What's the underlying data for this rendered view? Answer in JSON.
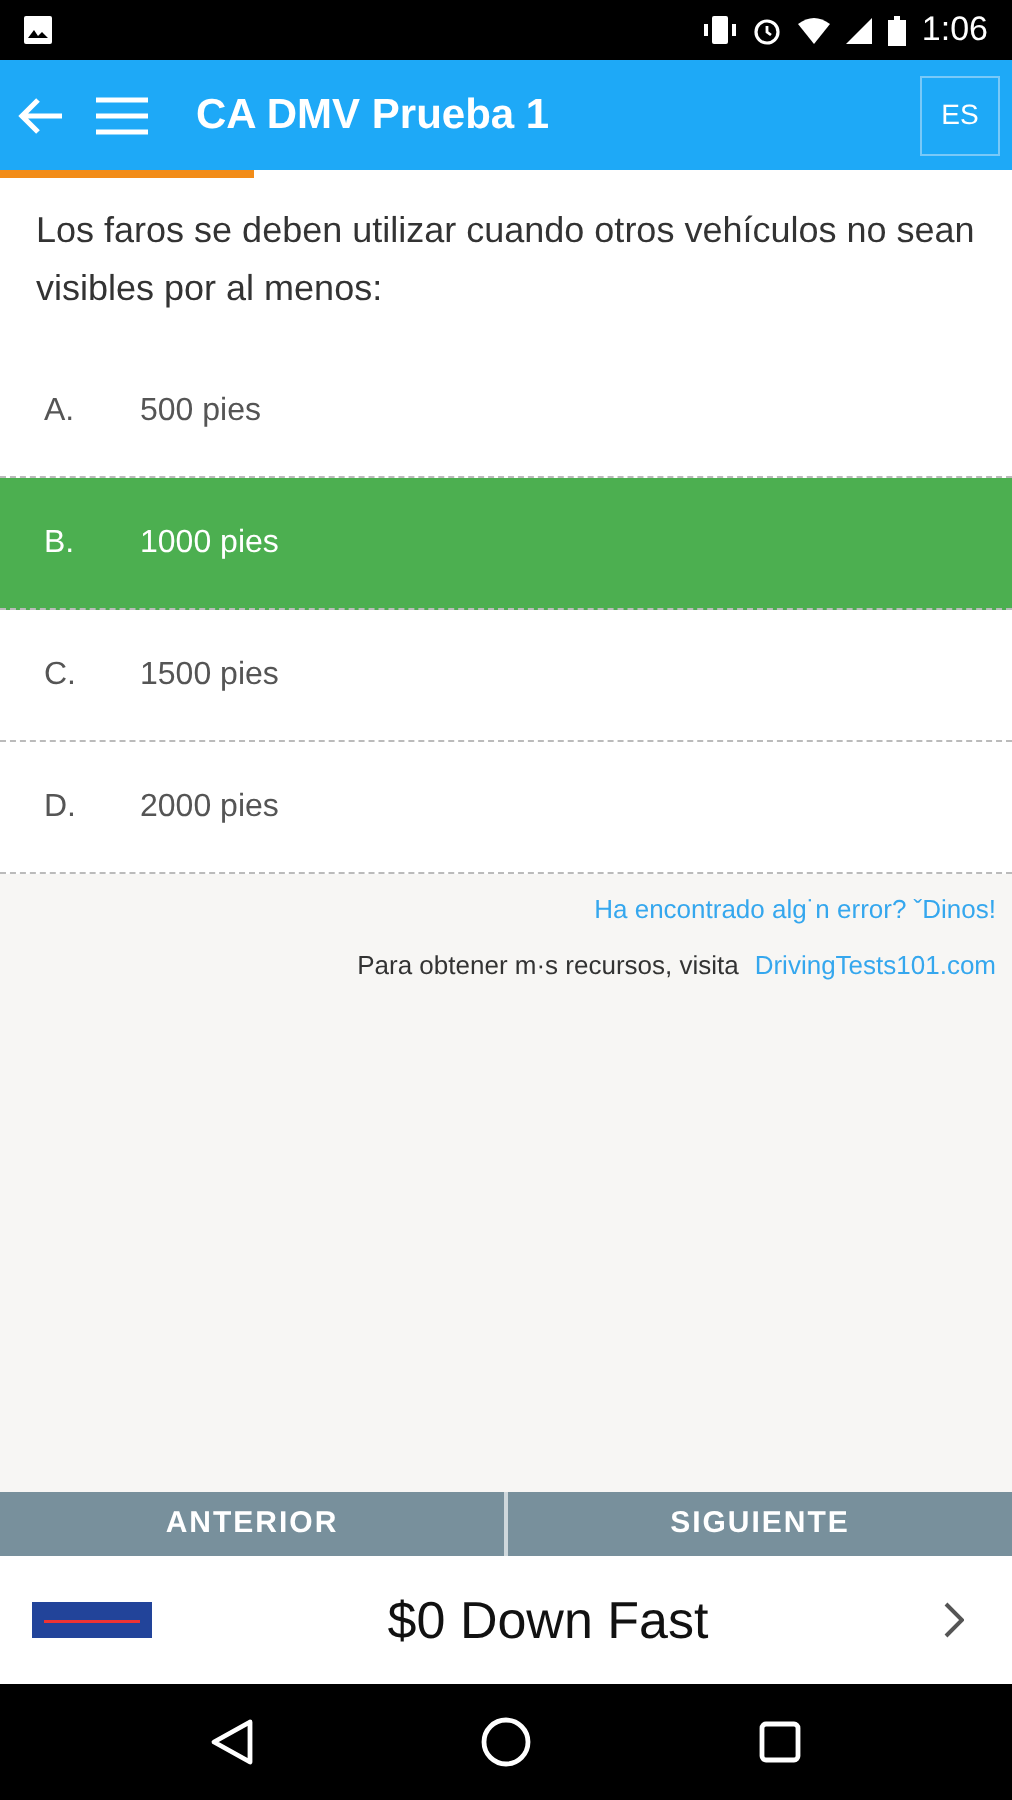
{
  "status_bar": {
    "time": "1:06"
  },
  "app_bar": {
    "title": "CA DMV Prueba 1",
    "language": "ES"
  },
  "progress": {
    "level": 0.25
  },
  "question": "Los faros se deben utilizar cuando otros vehículos no sean visibles por al menos:",
  "options": [
    {
      "letter": "A.",
      "text": "500 pies",
      "selected": false
    },
    {
      "letter": "B.",
      "text": "1000 pies",
      "selected": true
    },
    {
      "letter": "C.",
      "text": "1500 pies",
      "selected": false
    },
    {
      "letter": "D.",
      "text": "2000 pies",
      "selected": false
    }
  ],
  "report_link": "Ha encontrado alg˙n error? ˇDinos!",
  "resources": {
    "text": "Para obtener m·s recursos, visita",
    "link": "DrivingTests101.com"
  },
  "nav_buttons": [
    "ANTERIOR",
    "SIGUIENTE"
  ],
  "ad": {
    "headline": "$0 Down Fast"
  }
}
